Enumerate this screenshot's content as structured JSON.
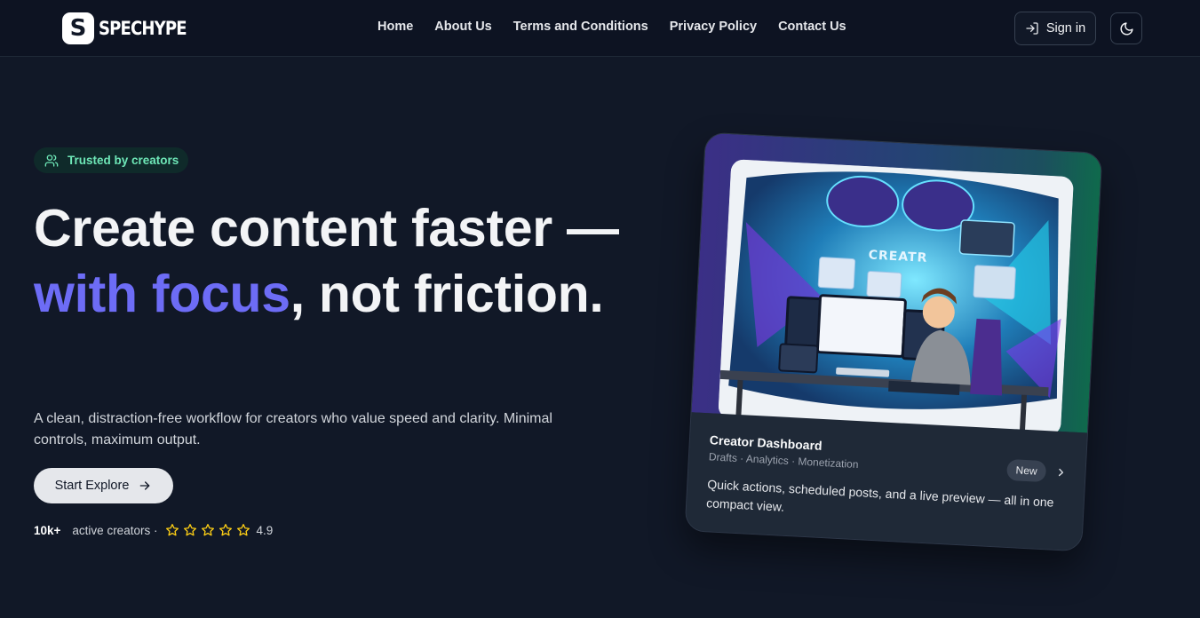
{
  "brand": {
    "name": "SPECHYPE",
    "logo_letter": "S"
  },
  "nav": {
    "items": [
      {
        "label": "Home"
      },
      {
        "label": "About Us"
      },
      {
        "label": "Terms and Conditions"
      },
      {
        "label": "Privacy Policy"
      },
      {
        "label": "Contact Us"
      }
    ]
  },
  "header_actions": {
    "signin_label": "Sign in",
    "signin_icon": "login-icon",
    "theme_icon": "moon-icon"
  },
  "hero": {
    "badge": "Trusted by creators",
    "badge_icon": "users-icon",
    "headline_before": "Create content faster — ",
    "headline_accent": "with focus",
    "headline_after": ", not friction.",
    "subtext": "A clean, distraction-free workflow for creators who value speed and clarity. Minimal controls, maximum output.",
    "cta_label": "Start Explore",
    "cta_icon": "arrow-right-icon",
    "stats_count": "10k+",
    "stats_label": "active creators ·",
    "stars": 5,
    "rating": "4.9"
  },
  "card": {
    "image_text": "CREATR",
    "title": "Creator Dashboard",
    "subtitle": "Drafts · Analytics · Monetization",
    "tag": "New",
    "description": "Quick actions, scheduled posts, and a live preview — all in one compact view."
  },
  "colors": {
    "background": "#111827",
    "header": "#0d1322",
    "accent": "#6d6cf6",
    "badge_text": "#6ee7b7",
    "star": "#facc15"
  }
}
